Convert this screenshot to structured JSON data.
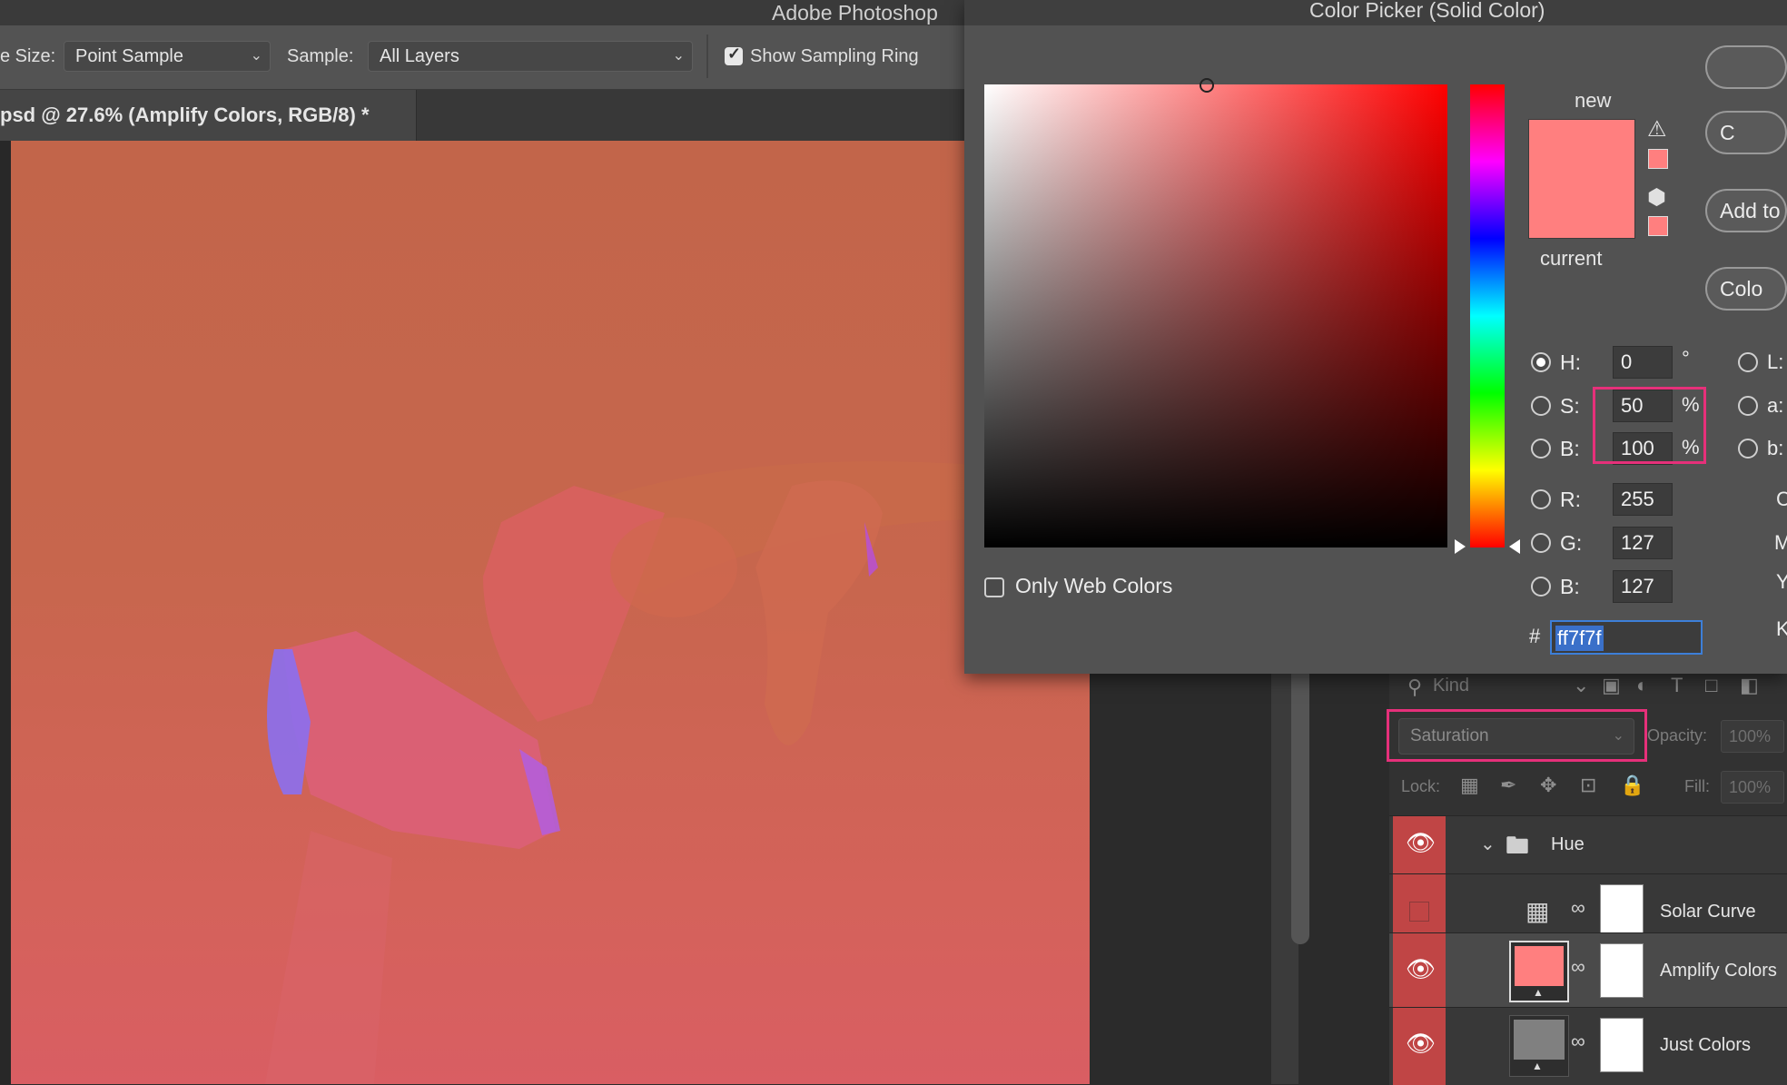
{
  "app": {
    "title": "Adobe Photoshop"
  },
  "options_bar": {
    "sample_size_label": "e Size:",
    "sample_size_value": "Point Sample",
    "sample_label": "Sample:",
    "sample_value": "All Layers",
    "show_ring_label": "Show Sampling Ring",
    "show_ring_checked": true
  },
  "document_tab": {
    "label": "psd @ 27.6% (Amplify Colors, RGB/8) *"
  },
  "color_picker": {
    "title": "Color Picker (Solid Color)",
    "new_label": "new",
    "current_label": "current",
    "new_color": "#ff7f7f",
    "current_color": "#ff7f7f",
    "only_web_colors_label": "Only Web Colors",
    "only_web_colors_checked": false,
    "buttons": {
      "ok": "",
      "cancel": "C",
      "add_to_swatches": "Add to",
      "color_libraries": "Colo"
    },
    "hsb": {
      "h_label": "H:",
      "h": "0",
      "h_unit": "°",
      "s_label": "S:",
      "s": "50",
      "s_unit": "%",
      "b_label": "B:",
      "b": "100",
      "b_unit": "%"
    },
    "rgb": {
      "r_label": "R:",
      "r": "255",
      "g_label": "G:",
      "g": "127",
      "b_label": "B:",
      "b": "127"
    },
    "lab_labels": {
      "l": "L:",
      "a": "a:",
      "b": "b:"
    },
    "cmyk_labels": {
      "c": "C",
      "m": "M",
      "y": "Y",
      "k": "K"
    },
    "hex_label": "#",
    "hex": "ff7f7f",
    "highlight_color": "#e6307a"
  },
  "layers_panel": {
    "filter_kind": "Kind",
    "blend_mode": "Saturation",
    "opacity_label": "Opacity:",
    "opacity_value": "100%",
    "lock_label": "Lock:",
    "fill_label": "Fill:",
    "fill_value": "100%",
    "layers": [
      {
        "name": "Hue",
        "type": "group",
        "visible": true
      },
      {
        "name": "Solar Curve",
        "type": "curves",
        "visible": false
      },
      {
        "name": "Amplify Colors",
        "type": "solid-color",
        "visible": true,
        "selected": true
      },
      {
        "name": "Just Colors",
        "type": "solid-color",
        "visible": true
      }
    ]
  }
}
